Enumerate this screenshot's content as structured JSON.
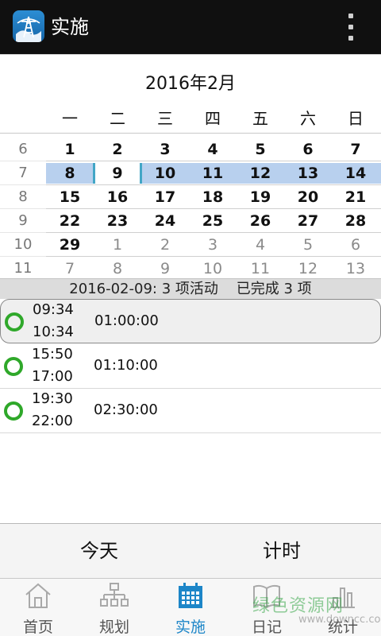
{
  "app": {
    "title": "实施",
    "icon": "power-tower-icon"
  },
  "calendar": {
    "month_title": "2016年2月",
    "weekdays": [
      "一",
      "二",
      "三",
      "四",
      "五",
      "六",
      "日"
    ],
    "week_numbers": [
      "6",
      "7",
      "8",
      "9",
      "10",
      "11"
    ],
    "weeks": [
      [
        "1",
        "2",
        "3",
        "4",
        "5",
        "6",
        "7"
      ],
      [
        "8",
        "9",
        "10",
        "11",
        "12",
        "13",
        "14"
      ],
      [
        "15",
        "16",
        "17",
        "18",
        "19",
        "20",
        "21"
      ],
      [
        "22",
        "23",
        "24",
        "25",
        "26",
        "27",
        "28"
      ],
      [
        "29",
        "1",
        "2",
        "3",
        "4",
        "5",
        "6"
      ],
      [
        "7",
        "8",
        "9",
        "10",
        "11",
        "12",
        "13"
      ]
    ],
    "selected_date": "9",
    "highlight_week": "7",
    "highlight_color": "#b8d0ee"
  },
  "summary": {
    "date": "2016-02-09:",
    "activities": "3 项活动",
    "completed": "已完成 3 项"
  },
  "activities": [
    {
      "start": "09:34",
      "end": "10:34",
      "duration": "01:00:00"
    },
    {
      "start": "15:50",
      "end": "17:00",
      "duration": "01:10:00"
    },
    {
      "start": "19:30",
      "end": "22:00",
      "duration": "02:30:00"
    }
  ],
  "status_color": "#2fa82a",
  "buttons": {
    "today": "今天",
    "timer": "计时"
  },
  "nav": [
    {
      "label": "首页",
      "icon": "home-icon"
    },
    {
      "label": "规划",
      "icon": "hierarchy-icon"
    },
    {
      "label": "实施",
      "icon": "calendar-icon",
      "active": true
    },
    {
      "label": "日记",
      "icon": "book-icon"
    },
    {
      "label": "统计",
      "icon": "bar-chart-icon"
    }
  ],
  "accent_color": "#1d86c8",
  "watermark": {
    "cn": "绿色资源网",
    "en": "www.downcc.com"
  }
}
